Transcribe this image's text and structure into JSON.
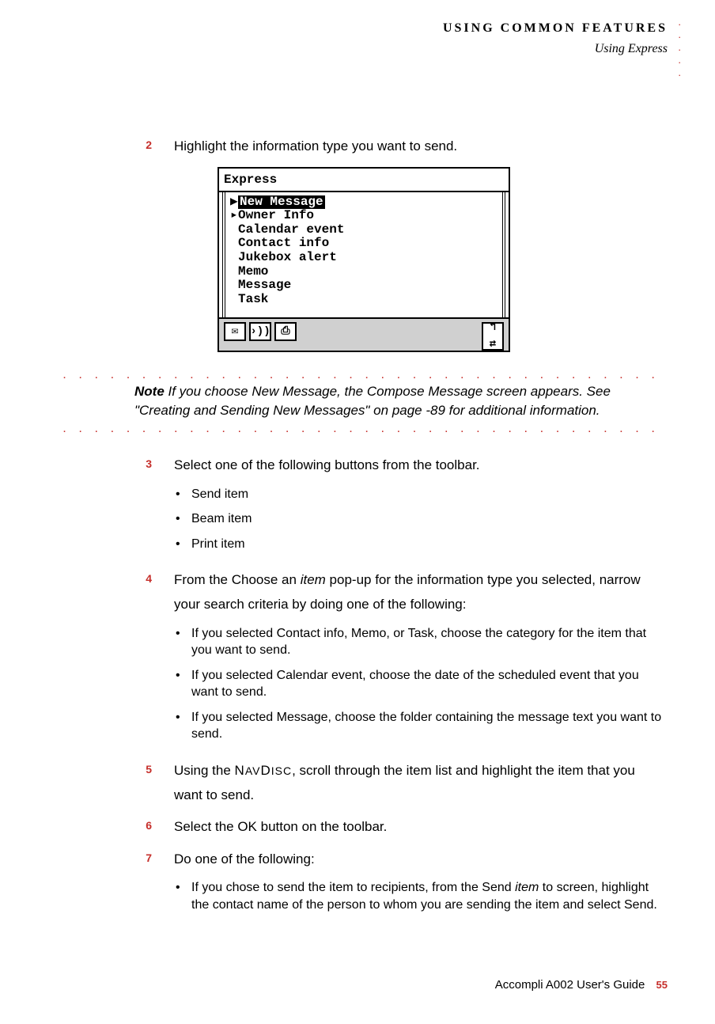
{
  "header": {
    "main": "USING COMMON FEATURES",
    "sub": "Using Express"
  },
  "steps": {
    "s2": {
      "num": "2",
      "text": "Highlight the information type you want to send."
    },
    "s3": {
      "num": "3",
      "text": "Select one of the following buttons from the toolbar.",
      "bullets": [
        "Send item",
        "Beam item",
        "Print item"
      ]
    },
    "s4": {
      "num": "4",
      "pre": "From the Choose an ",
      "ital": "item",
      "post": " pop-up for the information type you selected, narrow your search criteria by doing one of the following:",
      "bullets": [
        "If you selected Contact info, Memo, or Task, choose the category for the item that you want to send.",
        "If you selected Calendar event, choose the date of the scheduled event that you want to send.",
        "If you selected Message, choose the folder containing the message text you want to send."
      ]
    },
    "s5": {
      "num": "5",
      "pre": "Using the ",
      "nav": "NAVDISC",
      "post": ", scroll through the item list and highlight the item that you want to send."
    },
    "s6": {
      "num": "6",
      "text": "Select the OK button on the toolbar."
    },
    "s7": {
      "num": "7",
      "text": "Do one of the following:",
      "b_pre": "If you chose to send the item to recipients, from the Send ",
      "b_ital": "item",
      "b_post": " to screen, highlight the contact name of the person to whom you are sending the item and select Send."
    }
  },
  "device": {
    "title": "Express",
    "items": [
      "New Message",
      "Owner Info",
      "Calendar event",
      "Contact info",
      "Jukebox alert",
      "Memo",
      "Message",
      "Task"
    ]
  },
  "note": {
    "label": "Note",
    "text": " If you choose New Message, the Compose Message screen appears. See \"Creating and Sending New Messages\" on page -89 for additional information."
  },
  "footer": {
    "guide": "Accompli A002 User's Guide",
    "page": "55"
  }
}
